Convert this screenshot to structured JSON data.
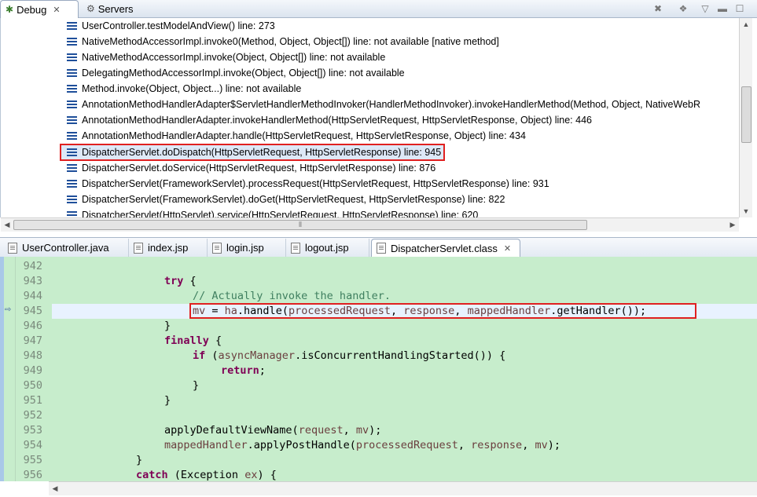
{
  "debug_view": {
    "tabs": [
      {
        "label": "Debug",
        "icon": "debug-bug-icon",
        "active": true,
        "closable": true
      },
      {
        "label": "Servers",
        "icon": "servers-icon",
        "active": false,
        "closable": false
      }
    ],
    "toolbar_icons": [
      "remove-all-terminated-icon",
      "debug-options-icon",
      "view-menu-icon",
      "minimize-icon",
      "maximize-icon"
    ],
    "stack_frames": [
      {
        "label": "UserController.testModelAndView() line: 273"
      },
      {
        "label": "NativeMethodAccessorImpl.invoke0(Method, Object, Object[]) line: not available [native method]"
      },
      {
        "label": "NativeMethodAccessorImpl.invoke(Object, Object[]) line: not available"
      },
      {
        "label": "DelegatingMethodAccessorImpl.invoke(Object, Object[]) line: not available"
      },
      {
        "label": "Method.invoke(Object, Object...) line: not available"
      },
      {
        "label": "AnnotationMethodHandlerAdapter$ServletHandlerMethodInvoker(HandlerMethodInvoker).invokeHandlerMethod(Method, Object, NativeWebR"
      },
      {
        "label": "AnnotationMethodHandlerAdapter.invokeHandlerMethod(HttpServletRequest, HttpServletResponse, Object) line: 446"
      },
      {
        "label": "AnnotationMethodHandlerAdapter.handle(HttpServletRequest, HttpServletResponse, Object) line: 434"
      },
      {
        "label": "DispatcherServlet.doDispatch(HttpServletRequest, HttpServletResponse) line: 945",
        "selected": true
      },
      {
        "label": "DispatcherServlet.doService(HttpServletRequest, HttpServletResponse) line: 876"
      },
      {
        "label": "DispatcherServlet(FrameworkServlet).processRequest(HttpServletRequest, HttpServletResponse) line: 931"
      },
      {
        "label": "DispatcherServlet(FrameworkServlet).doGet(HttpServletRequest, HttpServletResponse) line: 822"
      },
      {
        "label": "DispatcherServlet(HttpServlet).service(HttpServletRequest, HttpServletResponse) line: 620"
      }
    ]
  },
  "editor": {
    "tabs": [
      {
        "label": "UserController.java",
        "active": false
      },
      {
        "label": "index.jsp",
        "active": false
      },
      {
        "label": "login.jsp",
        "active": false
      },
      {
        "label": "logout.jsp",
        "active": false
      },
      {
        "label": "DispatcherServlet.class",
        "active": true,
        "closable": true
      }
    ],
    "current_line": "945",
    "lines": [
      {
        "no": "942"
      },
      {
        "no": "943"
      },
      {
        "no": "944"
      },
      {
        "no": "945"
      },
      {
        "no": "946"
      },
      {
        "no": "947"
      },
      {
        "no": "948"
      },
      {
        "no": "949"
      },
      {
        "no": "950"
      },
      {
        "no": "951"
      },
      {
        "no": "952"
      },
      {
        "no": "953"
      },
      {
        "no": "954"
      },
      {
        "no": "955"
      },
      {
        "no": "956"
      }
    ],
    "code": {
      "l943_kw": "try",
      "l943_rest": " {",
      "l944_comment": "// Actually invoke the handler.",
      "l945_mv": "mv",
      "l945_eq": " = ",
      "l945_ha": "ha",
      "l945_call": ".handle(",
      "l945_pr": "processedRequest",
      "l945_c1": ", ",
      "l945_resp": "response",
      "l945_c2": ", ",
      "l945_mh": "mappedHandler",
      "l945_tail": ".getHandler());",
      "l946": "}",
      "l947_kw": "finally",
      "l947_rest": " {",
      "l948_kw": "if",
      "l948_open": " (",
      "l948_am": "asyncManager",
      "l948_tail": ".isConcurrentHandlingStarted()) {",
      "l949_kw": "return",
      "l949_tail": ";",
      "l950": "}",
      "l951": "}",
      "l953_call": "applyDefaultViewName(",
      "l953_req": "request",
      "l953_c": ", ",
      "l953_mv": "mv",
      "l953_tail": ");",
      "l954_mh": "mappedHandler",
      "l954_call": ".applyPostHandle(",
      "l954_pr": "processedRequest",
      "l954_c1": ", ",
      "l954_resp": "response",
      "l954_c2": ", ",
      "l954_mv": "mv",
      "l954_tail": ");",
      "l955": "}",
      "l956_kw": "catch",
      "l956_open": " (Exception ",
      "l956_ex": "ex",
      "l956_tail": ") {"
    }
  }
}
